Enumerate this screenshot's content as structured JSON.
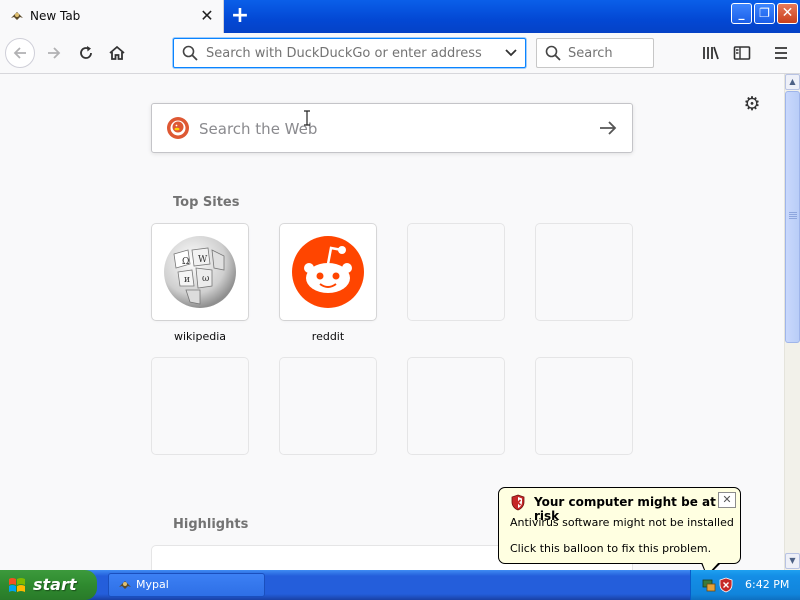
{
  "tab": {
    "title": "New Tab"
  },
  "navbar": {
    "url_placeholder": "Search with DuckDuckGo or enter address",
    "search_placeholder": "Search"
  },
  "newtab": {
    "websearch_placeholder": "Search the Web",
    "top_sites_title": "Top Sites",
    "top_sites": [
      {
        "label": "wikipedia",
        "icon": "wikipedia-globe-icon"
      },
      {
        "label": "reddit",
        "icon": "reddit-alien-icon"
      }
    ],
    "highlights_title": "Highlights"
  },
  "balloon": {
    "title": "Your computer might be at risk",
    "line1": "Antivirus software might not be installed",
    "line2": "Click this balloon to fix this problem.",
    "close_label": "✕"
  },
  "taskbar": {
    "start_label": "start",
    "task_label": "Mypal",
    "clock": "6:42 PM"
  },
  "colors": {
    "accent": "#0a84ff",
    "xp_blue": "#245edb",
    "start_green": "#2f8a2f",
    "balloon_bg": "#ffffe1",
    "reddit_orange": "#ff4500"
  }
}
